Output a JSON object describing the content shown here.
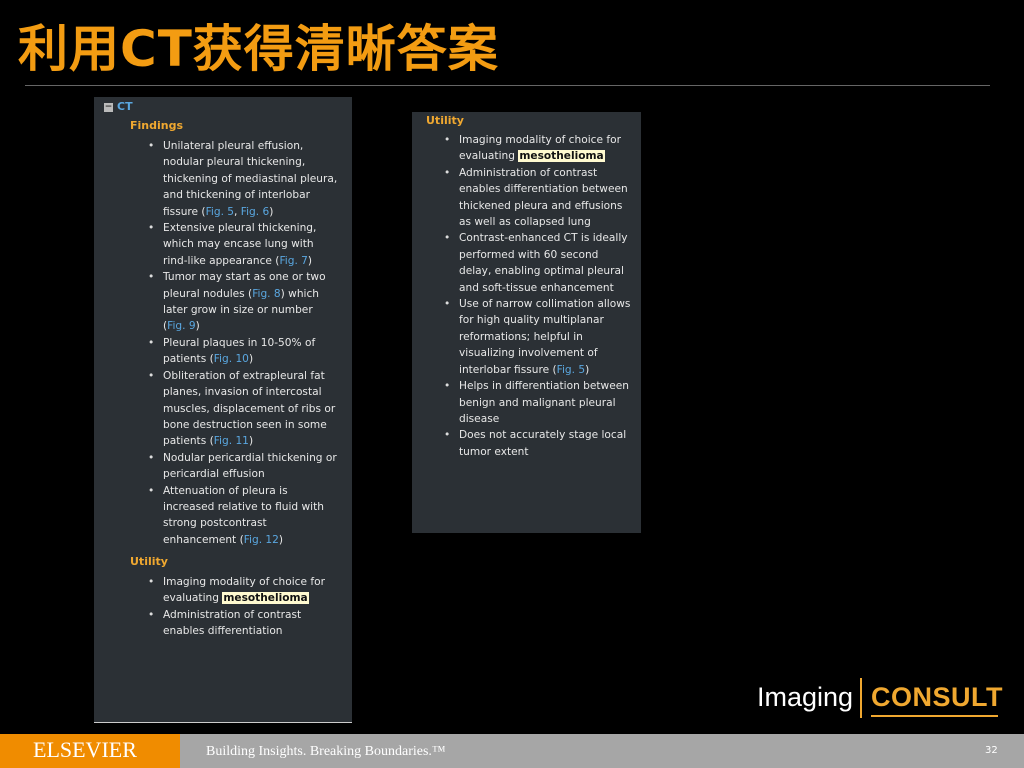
{
  "slide": {
    "title": "利用CT获得清晰答案",
    "page_number": "32"
  },
  "left_panel": {
    "header": "CT",
    "findings_heading": "Findings",
    "findings": [
      {
        "text": "Unilateral pleural effusion, nodular pleural thickening, thickening of mediastinal pleura, and thickening of interlobar fissure (",
        "refs": [
          "Fig. 5",
          "Fig. 6"
        ],
        "end": ")"
      },
      {
        "text": "Extensive pleural thickening, which may encase lung with rind-like appearance (",
        "refs": [
          "Fig. 7"
        ],
        "end": ")"
      },
      {
        "text": "Tumor may start as one or two pleural nodules (",
        "refs": [
          "Fig. 8"
        ],
        "mid": ") which later grow in size or number (",
        "refs2": [
          "Fig. 9"
        ],
        "end": ")"
      },
      {
        "text": "Pleural plaques in 10-50% of patients (",
        "refs": [
          "Fig. 10"
        ],
        "end": ")"
      },
      {
        "text": "Obliteration of extrapleural fat planes, invasion of intercostal muscles, displacement of ribs or bone destruction seen in some patients (",
        "refs": [
          "Fig. 11"
        ],
        "end": ")"
      },
      {
        "text": "Nodular pericardial thickening or pericardial effusion"
      },
      {
        "text": "Attenuation of pleura is increased relative to fluid with strong postcontrast enhancement (",
        "refs": [
          "Fig. 12"
        ],
        "end": ")"
      }
    ],
    "utility_heading": "Utility",
    "utility": [
      {
        "text": "Imaging modality of choice for evaluating ",
        "highlight": "mesothelioma"
      },
      {
        "text": "Administration of contrast enables differentiation"
      }
    ]
  },
  "right_panel": {
    "utility_heading": "Utility",
    "utility": [
      {
        "text": "Imaging modality of choice for evaluating ",
        "highlight": "mesothelioma"
      },
      {
        "text": "Administration of contrast enables differentiation between thickened pleura and effusions as well as collapsed lung"
      },
      {
        "text": "Contrast-enhanced CT is ideally performed with 60 second delay, enabling optimal pleural and soft-tissue enhancement"
      },
      {
        "text": "Use of narrow collimation allows for high quality multiplanar reformations; helpful in visualizing involvement of interlobar fissure (",
        "refs": [
          "Fig. 5"
        ],
        "end": ")"
      },
      {
        "text": "Helps in differentiation between benign and malignant pleural disease"
      },
      {
        "text": "Does not accurately stage local tumor extent"
      }
    ]
  },
  "logo": {
    "imaging": "Imaging",
    "consult": "CONSULT"
  },
  "footer": {
    "publisher": "ELSEVIER",
    "tagline": "Building Insights. Breaking Boundaries.™"
  },
  "colors": {
    "title": "#f39c12",
    "heading": "#f0a830",
    "link": "#5aa7e0",
    "panel": "#2b3035",
    "footer": "#a6a6a6",
    "brand": "#f08c00"
  }
}
